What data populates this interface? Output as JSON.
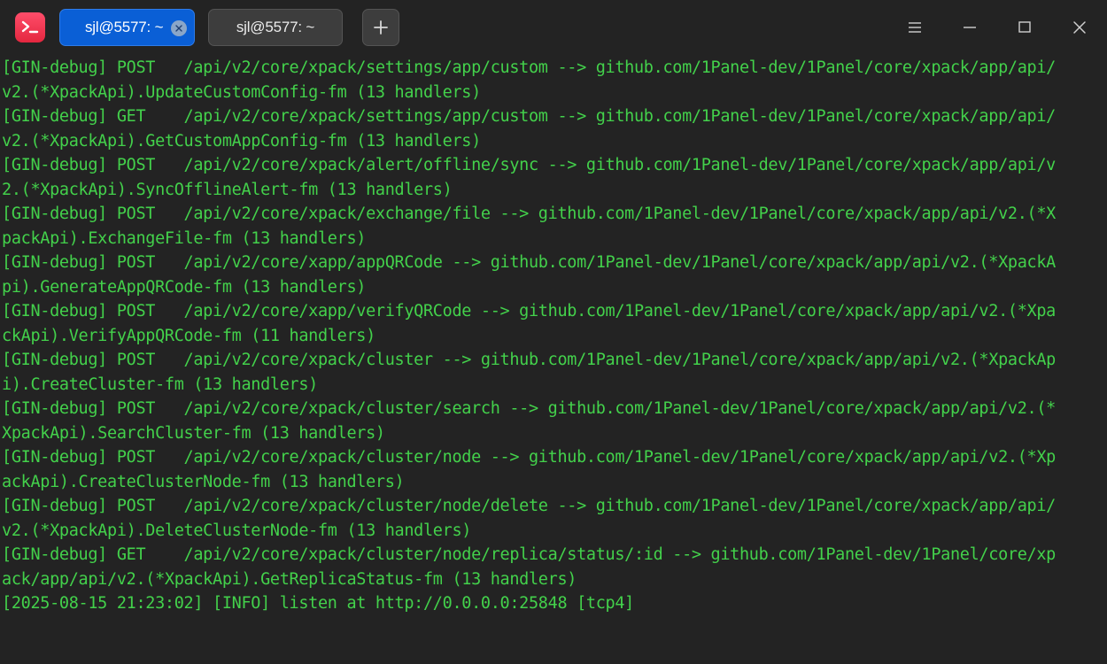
{
  "window": {
    "app_icon": "terminal-icon",
    "accent": "#0a5fd6",
    "text_color": "#43d14b",
    "background": "#232323"
  },
  "tabs": [
    {
      "label": "sjl@5577: ~",
      "active": true
    },
    {
      "label": "sjl@5577: ~",
      "active": false
    }
  ],
  "toolbar": {
    "new_tab_icon": "plus-icon",
    "menu_icon": "hamburger-icon",
    "minimize_icon": "minimize-icon",
    "maximize_icon": "maximize-icon",
    "close_icon": "close-icon"
  },
  "terminal": {
    "lines": [
      "[GIN-debug] POST   /api/v2/core/xpack/settings/app/custom --> github.com/1Panel-dev/1Panel/core/xpack/app/api/",
      "v2.(*XpackApi).UpdateCustomConfig-fm (13 handlers)",
      "[GIN-debug] GET    /api/v2/core/xpack/settings/app/custom --> github.com/1Panel-dev/1Panel/core/xpack/app/api/",
      "v2.(*XpackApi).GetCustomAppConfig-fm (13 handlers)",
      "[GIN-debug] POST   /api/v2/core/xpack/alert/offline/sync --> github.com/1Panel-dev/1Panel/core/xpack/app/api/v",
      "2.(*XpackApi).SyncOfflineAlert-fm (13 handlers)",
      "[GIN-debug] POST   /api/v2/core/xpack/exchange/file --> github.com/1Panel-dev/1Panel/core/xpack/app/api/v2.(*X",
      "packApi).ExchangeFile-fm (13 handlers)",
      "[GIN-debug] POST   /api/v2/core/xapp/appQRCode --> github.com/1Panel-dev/1Panel/core/xpack/app/api/v2.(*XpackA",
      "pi).GenerateAppQRCode-fm (13 handlers)",
      "[GIN-debug] POST   /api/v2/core/xapp/verifyQRCode --> github.com/1Panel-dev/1Panel/core/xpack/app/api/v2.(*Xpa",
      "ckApi).VerifyAppQRCode-fm (11 handlers)",
      "[GIN-debug] POST   /api/v2/core/xpack/cluster --> github.com/1Panel-dev/1Panel/core/xpack/app/api/v2.(*XpackAp",
      "i).CreateCluster-fm (13 handlers)",
      "[GIN-debug] POST   /api/v2/core/xpack/cluster/search --> github.com/1Panel-dev/1Panel/core/xpack/app/api/v2.(*",
      "XpackApi).SearchCluster-fm (13 handlers)",
      "[GIN-debug] POST   /api/v2/core/xpack/cluster/node --> github.com/1Panel-dev/1Panel/core/xpack/app/api/v2.(*Xp",
      "ackApi).CreateClusterNode-fm (13 handlers)",
      "[GIN-debug] POST   /api/v2/core/xpack/cluster/node/delete --> github.com/1Panel-dev/1Panel/core/xpack/app/api/",
      "v2.(*XpackApi).DeleteClusterNode-fm (13 handlers)",
      "[GIN-debug] GET    /api/v2/core/xpack/cluster/node/replica/status/:id --> github.com/1Panel-dev/1Panel/core/xp",
      "ack/app/api/v2.(*XpackApi).GetReplicaStatus-fm (13 handlers)",
      "[2025-08-15 21:23:02] [INFO] listen at http://0.0.0.0:25848 [tcp4]"
    ]
  }
}
